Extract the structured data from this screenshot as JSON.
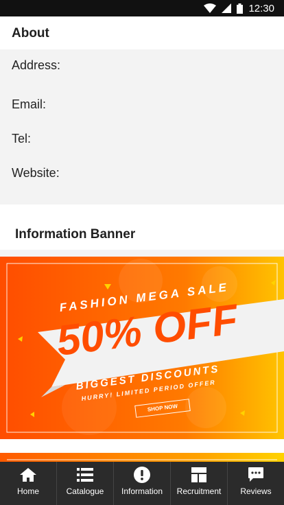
{
  "status_bar": {
    "time": "12:30"
  },
  "about": {
    "title": "About",
    "fields": {
      "address_label": "Address:",
      "address_value": "",
      "email_label": "Email:",
      "email_value": "",
      "tel_label": "Tel:",
      "tel_value": "",
      "website_label": "Website:",
      "website_value": ""
    }
  },
  "banner_section": {
    "title": "Information Banner"
  },
  "promo": {
    "headline": "FASHION MEGA SALE",
    "big": "50% OFF",
    "subhead": "BIGGEST DISCOUNTS",
    "tagline": "HURRY! LIMITED PERIOD OFFER",
    "button": "SHOP NOW"
  },
  "bottom_nav": {
    "items": [
      {
        "label": "Home",
        "icon": "home-icon"
      },
      {
        "label": "Catalogue",
        "icon": "list-icon"
      },
      {
        "label": "Information",
        "icon": "info-icon"
      },
      {
        "label": "Recruitment",
        "icon": "layout-icon"
      },
      {
        "label": "Reviews",
        "icon": "chat-icon"
      }
    ]
  },
  "colors": {
    "nav_background": "#2b2b2b",
    "promo_orange": "#ff5a00",
    "promo_yellow": "#ffd200",
    "about_background": "#f3f3f3"
  }
}
